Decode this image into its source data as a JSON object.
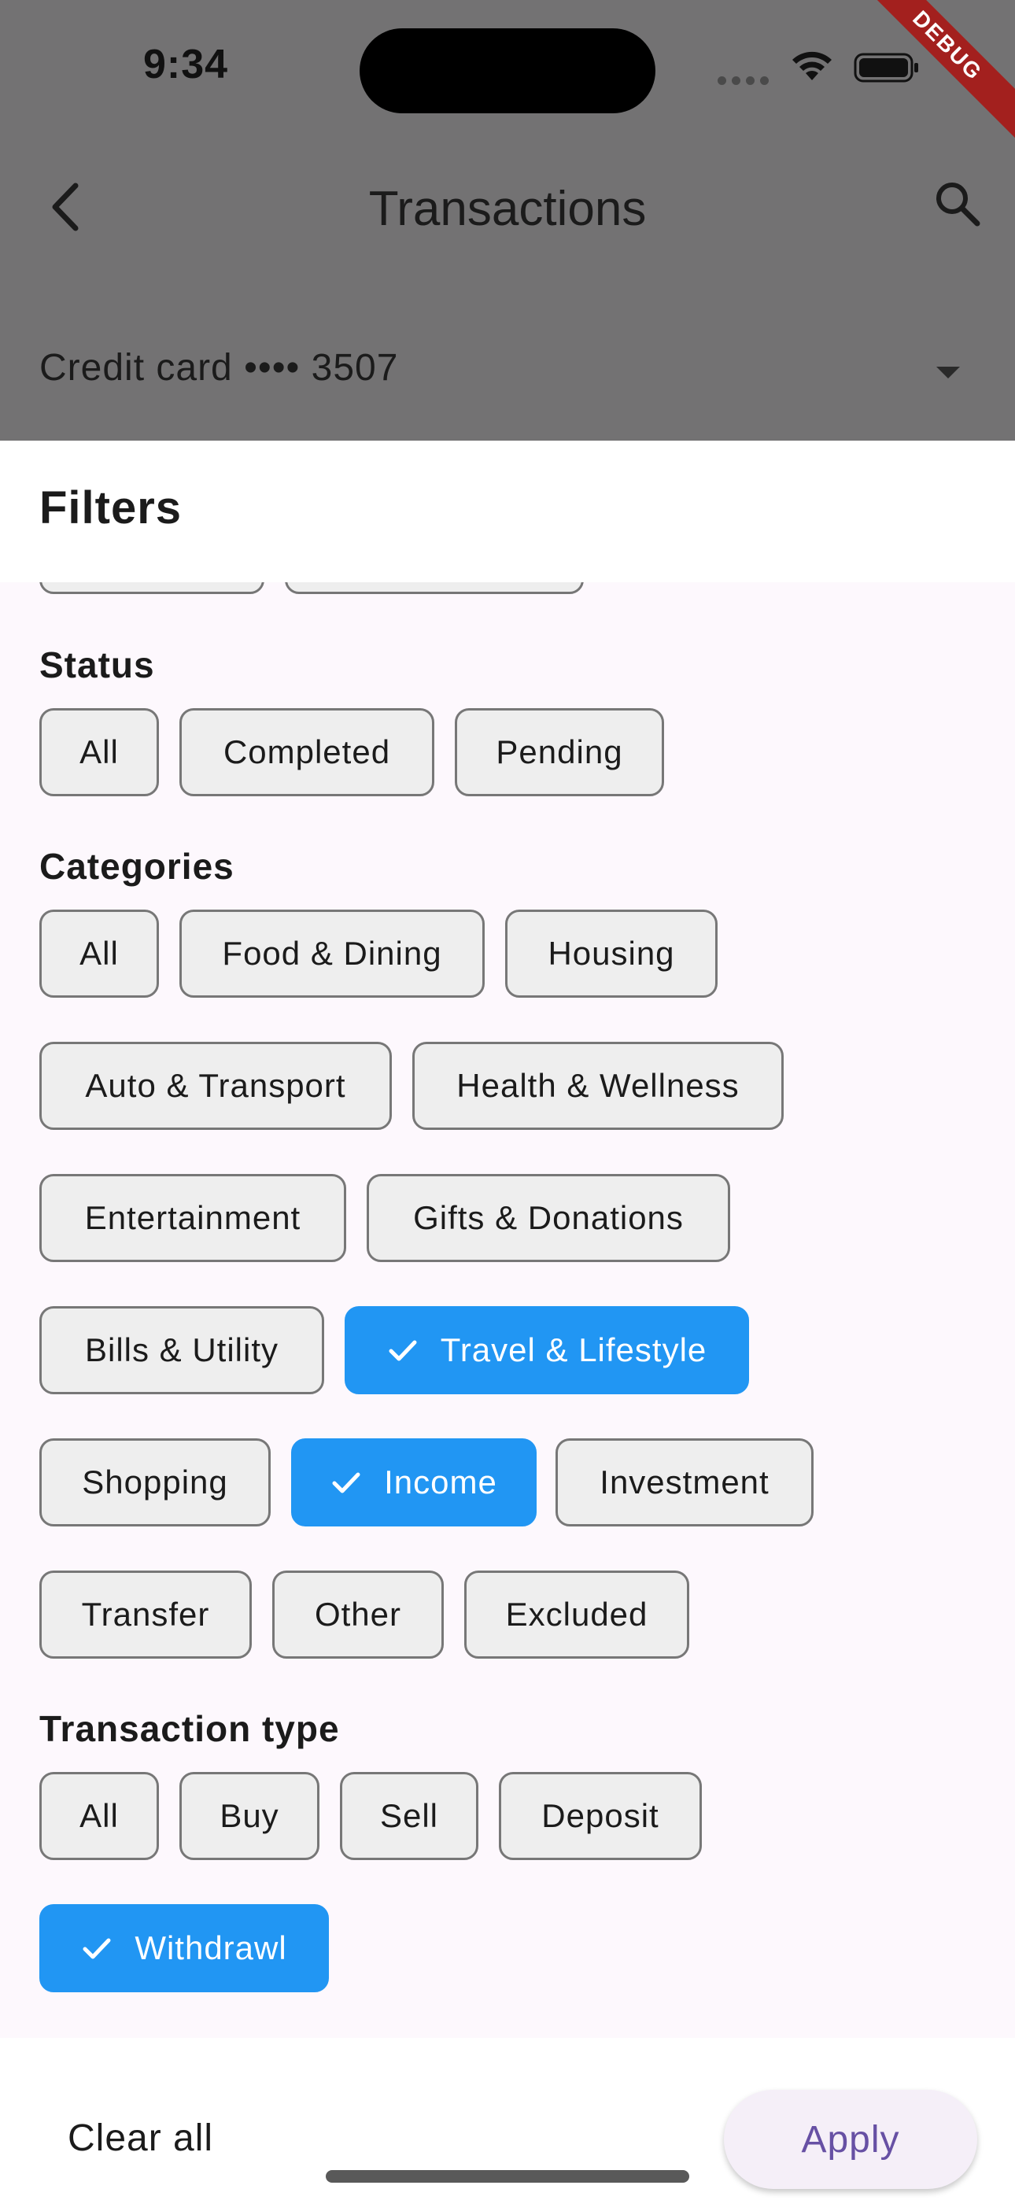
{
  "status_bar": {
    "time": "9:34",
    "debug_banner": "DEBUG"
  },
  "app_bar": {
    "title": "Transactions"
  },
  "account": {
    "label": "Credit card •••• 3507"
  },
  "sheet": {
    "title": "Filters",
    "status": {
      "title": "Status",
      "chips": [
        {
          "label": "All",
          "selected": false
        },
        {
          "label": "Completed",
          "selected": false
        },
        {
          "label": "Pending",
          "selected": false
        }
      ]
    },
    "categories": {
      "title": "Categories",
      "chips": [
        {
          "label": "All",
          "selected": false
        },
        {
          "label": "Food & Dining",
          "selected": false
        },
        {
          "label": "Housing",
          "selected": false
        },
        {
          "label": "Auto & Transport",
          "selected": false
        },
        {
          "label": "Health & Wellness",
          "selected": false
        },
        {
          "label": "Entertainment",
          "selected": false
        },
        {
          "label": "Gifts & Donations",
          "selected": false
        },
        {
          "label": "Bills & Utility",
          "selected": false
        },
        {
          "label": "Travel & Lifestyle",
          "selected": true
        },
        {
          "label": "Shopping",
          "selected": false
        },
        {
          "label": "Income",
          "selected": true
        },
        {
          "label": "Investment",
          "selected": false
        },
        {
          "label": "Transfer",
          "selected": false
        },
        {
          "label": "Other",
          "selected": false
        },
        {
          "label": "Excluded",
          "selected": false
        }
      ]
    },
    "transaction_type": {
      "title": "Transaction type",
      "chips": [
        {
          "label": "All",
          "selected": false
        },
        {
          "label": "Buy",
          "selected": false
        },
        {
          "label": "Sell",
          "selected": false
        },
        {
          "label": "Deposit",
          "selected": false
        },
        {
          "label": "Withdrawl",
          "selected": true
        }
      ]
    },
    "footer": {
      "clear_label": "Clear all",
      "apply_label": "Apply"
    }
  },
  "colors": {
    "scrim_background": "#737273",
    "selected_chip": "#2196f3",
    "unselected_chip": "#eeeeee",
    "apply_text": "#6750a4",
    "debug_ribbon": "#a3201e"
  },
  "icons": [
    "back-arrow-icon",
    "search-icon",
    "dropdown-arrow-icon",
    "check-icon",
    "wifi-icon",
    "battery-icon",
    "signal-icon"
  ]
}
